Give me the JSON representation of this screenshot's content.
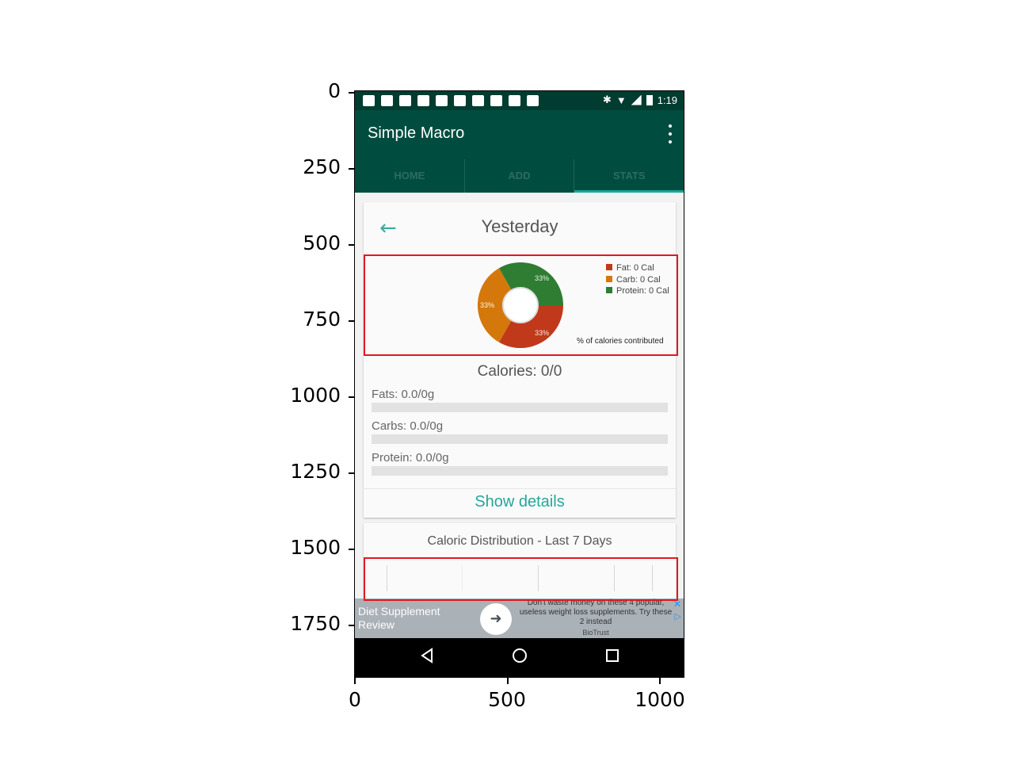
{
  "axes": {
    "y_ticks": [
      "0",
      "250",
      "500",
      "750",
      "1000",
      "1250",
      "1500",
      "1750"
    ],
    "x_ticks": [
      "0",
      "500",
      "1000"
    ]
  },
  "status_bar": {
    "time": "1:19"
  },
  "app_bar": {
    "title": "Simple Macro",
    "menu_icon": "more-vert-icon"
  },
  "tabs": [
    {
      "label": "HOME",
      "active": false
    },
    {
      "label": "ADD",
      "active": false
    },
    {
      "label": "STATS",
      "active": true
    }
  ],
  "day_card": {
    "back_icon": "arrow-back-icon",
    "date_label": "Yesterday",
    "pie": {
      "slices": [
        {
          "label": "33%",
          "color": "#c0391b"
        },
        {
          "label": "33%",
          "color": "#d4780c"
        },
        {
          "label": "33%",
          "color": "#2e7d32"
        }
      ],
      "legend": [
        {
          "label": "Fat: 0 Cal",
          "color": "#c0391b"
        },
        {
          "label": "Carb: 0 Cal",
          "color": "#d4780c"
        },
        {
          "label": "Protein: 0 Cal",
          "color": "#2e7d32"
        }
      ],
      "description": "% of calories contributed"
    },
    "calories": "Calories: 0/0",
    "macros": [
      {
        "label": "Fats: 0.0/0g",
        "progress": 0
      },
      {
        "label": "Carbs: 0.0/0g",
        "progress": 0
      },
      {
        "label": "Protein: 0.0/0g",
        "progress": 0
      }
    ],
    "show_details": "Show details"
  },
  "week_card": {
    "title": "Caloric Distribution - Last 7 Days"
  },
  "ad": {
    "title": "Diet Supplement Review",
    "text": "Don't waste money on these 4 popular, useless weight loss supplements. Try these 2 instead",
    "source": "BioTrust",
    "close_icon": "close-icon",
    "adchoices_icon": "adchoices-icon",
    "arrow_icon": "arrow-right-icon"
  },
  "nav_bar": {
    "back_icon": "nav-back-icon",
    "home_icon": "nav-home-icon",
    "recents_icon": "nav-recents-icon"
  }
}
